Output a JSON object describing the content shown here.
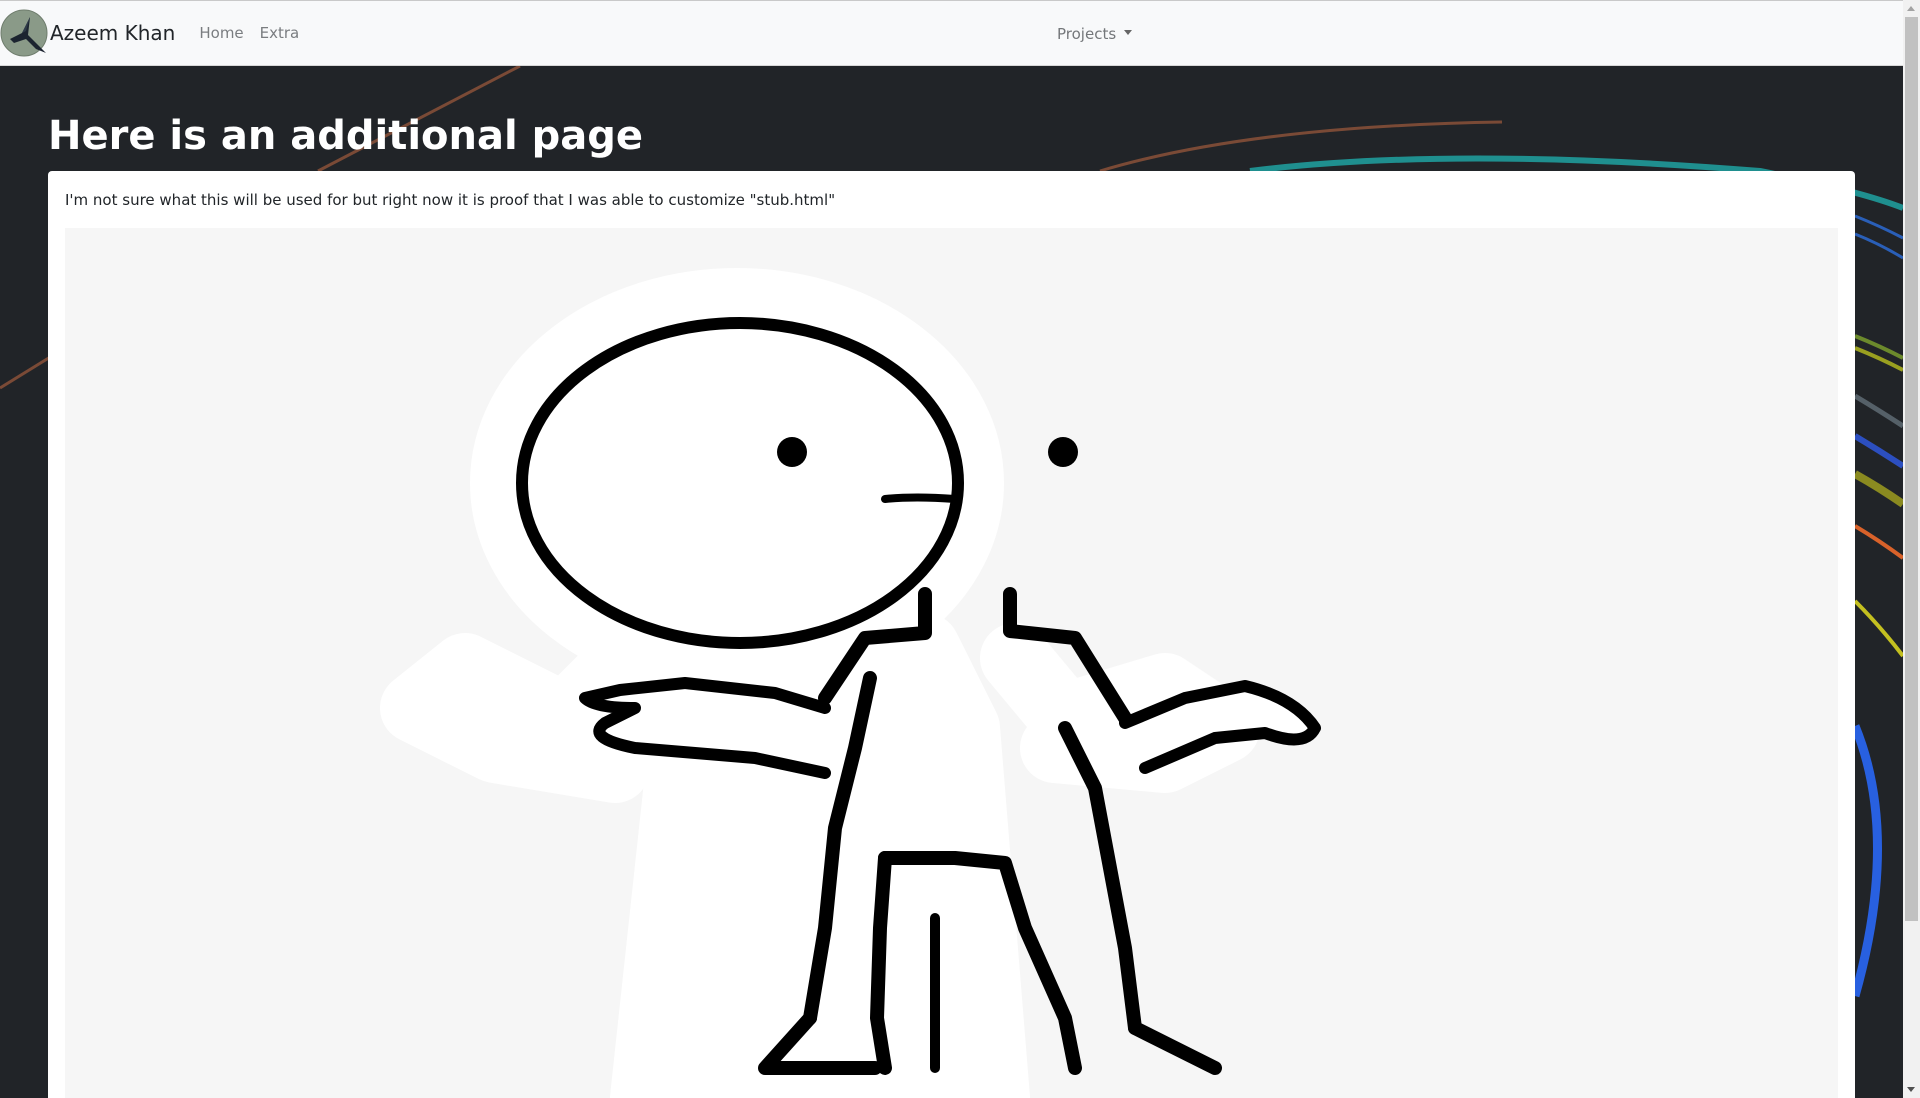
{
  "navbar": {
    "brand_name": "Azeem Khan",
    "links": [
      {
        "label": "Home"
      },
      {
        "label": "Extra"
      }
    ],
    "dropdown_label": "Projects"
  },
  "main": {
    "title": "Here is an additional page",
    "card_text": "I'm not sure what this will be used for but right now it is proof that I was able to customize \"stub.html\"",
    "image_description": "shrugging stick figure"
  },
  "colors": {
    "page_background": "#212428",
    "navbar_background": "#f8f9fa",
    "card_background": "#ffffff",
    "image_background": "#f6f6f6"
  }
}
